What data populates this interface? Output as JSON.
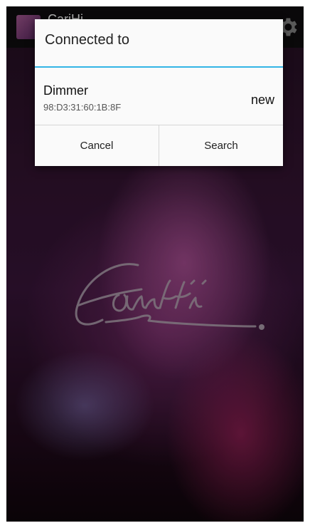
{
  "app_bar": {
    "title": "CariHi",
    "icon": "app-icon",
    "settings_icon": "gear-icon"
  },
  "background": {
    "logo_icon": "signature-logo-icon",
    "logo_color": "#9a8f99"
  },
  "dialog": {
    "title": "Connected to",
    "accent_color": "#33b5e5",
    "device": {
      "name": "Dimmer",
      "address": "98:D3:31:60:1B:8F",
      "status": "new"
    },
    "buttons": {
      "cancel": "Cancel",
      "search": "Search"
    }
  }
}
